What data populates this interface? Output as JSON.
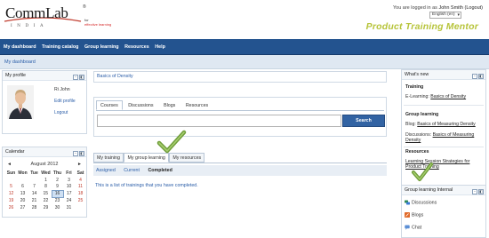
{
  "header": {
    "logo_text": "CommLab",
    "logo_sub": "INDIA",
    "logo_tag_line1": "for",
    "logo_tag_line2": "effective learning",
    "login_prefix": "You are logged in as",
    "login_user": "John Smith",
    "login_logout": "(Logout)",
    "language": "English (en)",
    "product_title": "Product Training Mentor"
  },
  "nav": {
    "items": [
      "My dashboard",
      "Training catalog",
      "Group learning",
      "Resources",
      "Help"
    ]
  },
  "breadcrumb": "My dashboard",
  "profile": {
    "title": "My profile",
    "name": "Ri John",
    "edit": "Edit profile",
    "logout": "Logout"
  },
  "calendar": {
    "title": "Calendar",
    "month": "August 2012",
    "prev": "◄",
    "next": "►",
    "days": [
      "Sun",
      "Mon",
      "Tue",
      "Wed",
      "Thu",
      "Fri",
      "Sat"
    ],
    "weeks": [
      [
        "",
        "",
        "",
        "1",
        "2",
        "3",
        "4"
      ],
      [
        "5",
        "6",
        "7",
        "8",
        "9",
        "10",
        "11"
      ],
      [
        "12",
        "13",
        "14",
        "15",
        "16",
        "17",
        "18"
      ],
      [
        "19",
        "20",
        "21",
        "22",
        "23",
        "24",
        "25"
      ],
      [
        "26",
        "27",
        "28",
        "29",
        "30",
        "31",
        ""
      ]
    ],
    "today": "16"
  },
  "center": {
    "basics_link": "Basics of Density",
    "search_tabs": [
      "Courses",
      "Discussions",
      "Blogs",
      "Resources"
    ],
    "search_button": "Search",
    "search_value": "",
    "training_tabs": [
      "My training",
      "My group learning",
      "My resources"
    ],
    "sub_tabs": [
      "Assigned",
      "Current",
      "Completed"
    ],
    "message": "This is a list of trainings that you have completed."
  },
  "whats_new": {
    "title": "What's new",
    "sections": [
      {
        "heading": "Training",
        "prefix": "E-Learning:",
        "link": "Basics of Density"
      },
      {
        "heading": "Group learning",
        "prefix": "Blog:",
        "link": "Basics of Measuring Density"
      },
      {
        "heading": "",
        "prefix": "Discussions:",
        "link": "Basics of Measuring Density"
      },
      {
        "heading": "Resources",
        "prefix": "",
        "link": "Learning Session Strategies for Product Training"
      }
    ]
  },
  "group_learning": {
    "title": "Group learning Internal",
    "items": [
      "Discussions",
      "Blogs",
      "Chat"
    ]
  },
  "colors": {
    "nav_bg": "#23538f",
    "accent_green": "#b7c43a",
    "link_blue": "#2a5da8",
    "check_green": "#6f9c3a"
  }
}
